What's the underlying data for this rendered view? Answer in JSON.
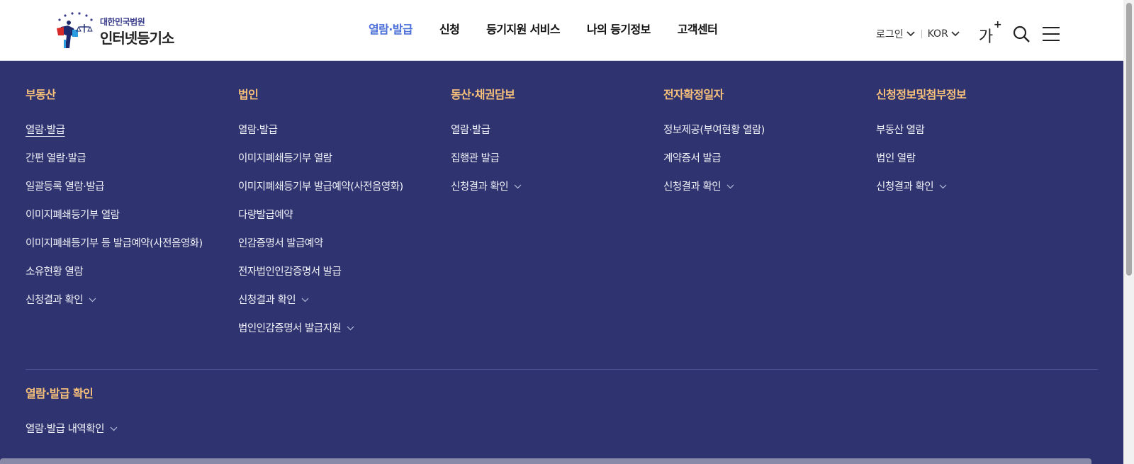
{
  "header": {
    "logo": {
      "org": "대한민국법원",
      "name": "인터넷등기소"
    },
    "nav": [
      {
        "label": "열람·발급",
        "active": true
      },
      {
        "label": "신청",
        "active": false
      },
      {
        "label": "등기지원 서비스",
        "active": false
      },
      {
        "label": "나의 등기정보",
        "active": false
      },
      {
        "label": "고객센터",
        "active": false
      }
    ],
    "util": {
      "login": "로그인",
      "language": "KOR",
      "font_size_label": "가",
      "font_size_plus": "+"
    }
  },
  "menu": {
    "columns": [
      {
        "title": "부동산",
        "items": [
          {
            "label": "열람·발급",
            "active": true,
            "expandable": false
          },
          {
            "label": "간편 열람·발급",
            "expandable": false
          },
          {
            "label": "일괄등록 열람·발급",
            "expandable": false
          },
          {
            "label": "이미지폐쇄등기부 열람",
            "expandable": false
          },
          {
            "label": "이미지폐쇄등기부 등 발급예약(사전음영화)",
            "expandable": false
          },
          {
            "label": "소유현황 열람",
            "expandable": false
          },
          {
            "label": "신청결과 확인",
            "expandable": true
          }
        ]
      },
      {
        "title": "법인",
        "items": [
          {
            "label": "열람·발급",
            "expandable": false
          },
          {
            "label": "이미지폐쇄등기부 열람",
            "expandable": false
          },
          {
            "label": "이미지폐쇄등기부 발급예약(사전음영화)",
            "expandable": false
          },
          {
            "label": "다량발급예약",
            "expandable": false
          },
          {
            "label": "인감증명서 발급예약",
            "expandable": false
          },
          {
            "label": "전자법인인감증명서 발급",
            "expandable": false
          },
          {
            "label": "신청결과 확인",
            "expandable": true
          },
          {
            "label": "법인인감증명서 발급지원",
            "expandable": true
          }
        ]
      },
      {
        "title": "동산·채권담보",
        "items": [
          {
            "label": "열람·발급",
            "expandable": false
          },
          {
            "label": "집행관 발급",
            "expandable": false
          },
          {
            "label": "신청결과 확인",
            "expandable": true
          }
        ]
      },
      {
        "title": "전자확정일자",
        "items": [
          {
            "label": "정보제공(부여현황 열람)",
            "expandable": false
          },
          {
            "label": "계약증서 발급",
            "expandable": false
          },
          {
            "label": "신청결과 확인",
            "expandable": true
          }
        ]
      },
      {
        "title": "신청정보및첨부정보",
        "items": [
          {
            "label": "부동산 열람",
            "expandable": false
          },
          {
            "label": "법인 열람",
            "expandable": false
          },
          {
            "label": "신청결과 확인",
            "expandable": true
          }
        ]
      }
    ],
    "bottom": {
      "title": "열람·발급 확인",
      "items": [
        {
          "label": "열람·발급 내역확인",
          "expandable": true
        }
      ]
    }
  },
  "colors": {
    "menu_bg": "#2f3470",
    "heading": "#f7c07a",
    "nav_active": "#4a6fd8",
    "menu_text": "#f0f1f8"
  }
}
